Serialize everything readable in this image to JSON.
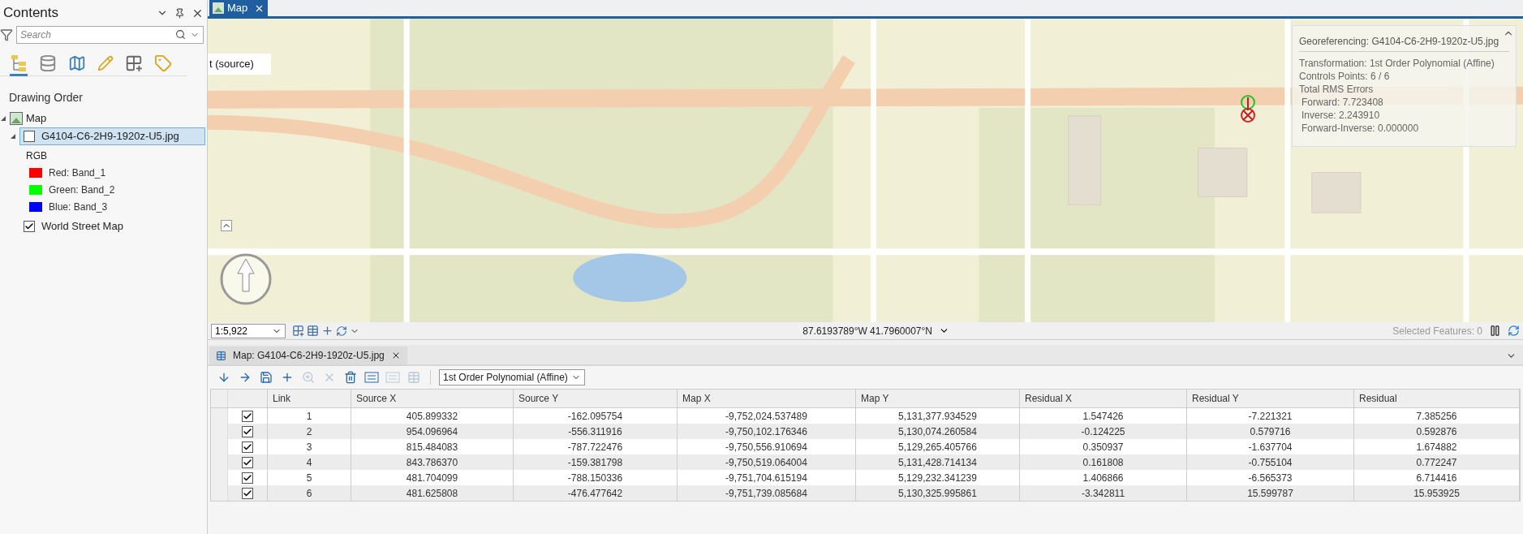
{
  "contents": {
    "title": "Contents",
    "search": {
      "placeholder": "Search"
    },
    "view_tabs": [
      {
        "kind": "drawing-order",
        "selected": true
      },
      {
        "kind": "data-source",
        "selected": false
      },
      {
        "kind": "map-layer",
        "selected": false
      },
      {
        "kind": "editing",
        "selected": false
      },
      {
        "kind": "selection",
        "selected": false
      },
      {
        "kind": "labeling",
        "selected": false
      }
    ],
    "heading": "Drawing Order",
    "tree": [
      {
        "label": "Map",
        "expanded": true,
        "children": [
          {
            "label": "G4104-C6-2H9-1920z-U5.jpg",
            "checked": false,
            "selected": true,
            "expanded": true,
            "legend": {
              "title": "RGB",
              "bands": [
                {
                  "label": "Red:",
                  "value": "Band_1",
                  "color": "#ff0000"
                },
                {
                  "label": "Green:",
                  "value": "Band_2",
                  "color": "#00ff00"
                },
                {
                  "label": "Blue:",
                  "value": "Band_3",
                  "color": "#0000ff"
                }
              ]
            }
          },
          {
            "label": "World Street Map",
            "checked": true,
            "selected": false
          }
        ]
      }
    ]
  },
  "map_tab": {
    "label": "Map",
    "selected": true
  },
  "map": {
    "source_label": "t (source)",
    "georef_panel": {
      "title": "Georeferencing: G4104-C6-2H9-1920z-U5.jpg",
      "lines": [
        {
          "kind": "main",
          "text": "Transformation: 1st Order Polynomial (Affine)"
        },
        {
          "kind": "main",
          "text": "Controls Points: 6 / 6"
        },
        {
          "kind": "main",
          "text": "Total RMS Errors"
        },
        {
          "kind": "sub",
          "text": "Forward: 7.723408"
        },
        {
          "kind": "sub",
          "text": "Inverse: 2.243910"
        },
        {
          "kind": "sub",
          "text": "Forward-Inverse: 0.000000"
        }
      ]
    },
    "status": {
      "scale": "1:5,922",
      "coordinates": "87.6193789°W 41.7960007°N",
      "selected_features": "Selected Features: 0"
    }
  },
  "table_tab": {
    "label": "Map: G4104-C6-2H9-1920z-U5.jpg",
    "selected": true
  },
  "toolbar": [
    {
      "kind": "import",
      "disabled": false
    },
    {
      "kind": "export",
      "disabled": false
    },
    {
      "kind": "save",
      "disabled": false
    },
    {
      "kind": "add",
      "disabled": false
    },
    {
      "kind": "zoom",
      "disabled": true
    },
    {
      "kind": "delete",
      "disabled": true
    },
    {
      "kind": "delete-all",
      "disabled": false
    },
    {
      "kind": "residual",
      "disabled": false
    },
    {
      "kind": "residual",
      "disabled": true
    },
    {
      "kind": "table",
      "disabled": true
    }
  ],
  "transformation": "1st Order Polynomial (Affine)",
  "table": {
    "columns": [
      "Link",
      "Source X",
      "Source Y",
      "Map X",
      "Map Y",
      "Residual X",
      "Residual Y",
      "Residual"
    ],
    "rows": [
      {
        "checked": true,
        "cells": [
          "1",
          "405.899332",
          "-162.095754",
          "-9,752,024.537489",
          "5,131,377.934529",
          "1.547426",
          "-7.221321",
          "7.385256"
        ]
      },
      {
        "checked": true,
        "cells": [
          "2",
          "954.096964",
          "-556.311916",
          "-9,750,102.176346",
          "5,130,074.260584",
          "-0.124225",
          "0.579716",
          "0.592876"
        ]
      },
      {
        "checked": true,
        "cells": [
          "3",
          "815.484083",
          "-787.722476",
          "-9,750,556.910694",
          "5,129,265.405766",
          "0.350937",
          "-1.637704",
          "1.674882"
        ]
      },
      {
        "checked": true,
        "cells": [
          "4",
          "843.786370",
          "-159.381798",
          "-9,750,519.064004",
          "5,131,428.714134",
          "0.161808",
          "-0.755104",
          "0.772247"
        ]
      },
      {
        "checked": true,
        "cells": [
          "5",
          "481.704099",
          "-788.150336",
          "-9,751,704.615194",
          "5,129,232.341239",
          "1.406866",
          "-6.565373",
          "6.714416"
        ]
      },
      {
        "checked": true,
        "cells": [
          "6",
          "481.625808",
          "-476.477642",
          "-9,751,739.085684",
          "5,130,325.995861",
          "-3.342811",
          "15.599787",
          "15.953925"
        ]
      }
    ]
  }
}
